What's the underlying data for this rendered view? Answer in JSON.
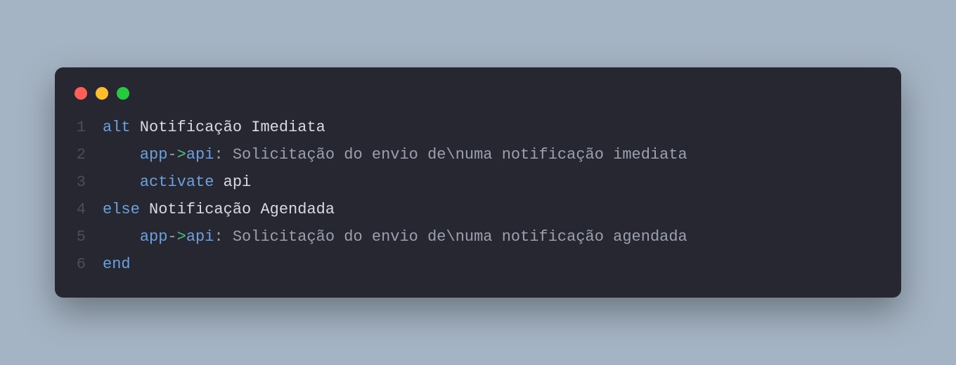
{
  "window": {
    "dots": [
      "red",
      "yellow",
      "green"
    ]
  },
  "code": {
    "lines": [
      {
        "num": "1",
        "tokens": [
          {
            "cls": "tok-kw",
            "t": "alt"
          },
          {
            "cls": "tok-label",
            "t": " Notificação Imediata"
          }
        ]
      },
      {
        "num": "2",
        "tokens": [
          {
            "cls": "",
            "t": "    "
          },
          {
            "cls": "tok-var",
            "t": "app"
          },
          {
            "cls": "tok-op",
            "t": "-"
          },
          {
            "cls": "tok-arrow",
            "t": ">"
          },
          {
            "cls": "tok-var",
            "t": "api"
          },
          {
            "cls": "tok-colon",
            "t": ":"
          },
          {
            "cls": "tok-text",
            "t": " Solicitação do envio de\\numa notificação imediata"
          }
        ]
      },
      {
        "num": "3",
        "tokens": [
          {
            "cls": "",
            "t": "    "
          },
          {
            "cls": "tok-kw",
            "t": "activate"
          },
          {
            "cls": "tok-label",
            "t": " api"
          }
        ]
      },
      {
        "num": "4",
        "tokens": [
          {
            "cls": "tok-kw",
            "t": "else"
          },
          {
            "cls": "tok-label",
            "t": " Notificação Agendada"
          }
        ]
      },
      {
        "num": "5",
        "tokens": [
          {
            "cls": "",
            "t": "    "
          },
          {
            "cls": "tok-var",
            "t": "app"
          },
          {
            "cls": "tok-op",
            "t": "-"
          },
          {
            "cls": "tok-arrow",
            "t": ">"
          },
          {
            "cls": "tok-var",
            "t": "api"
          },
          {
            "cls": "tok-colon",
            "t": ":"
          },
          {
            "cls": "tok-text",
            "t": " Solicitação do envio de\\numa notificação agendada"
          }
        ]
      },
      {
        "num": "6",
        "tokens": [
          {
            "cls": "tok-kw",
            "t": "end"
          }
        ]
      }
    ]
  }
}
